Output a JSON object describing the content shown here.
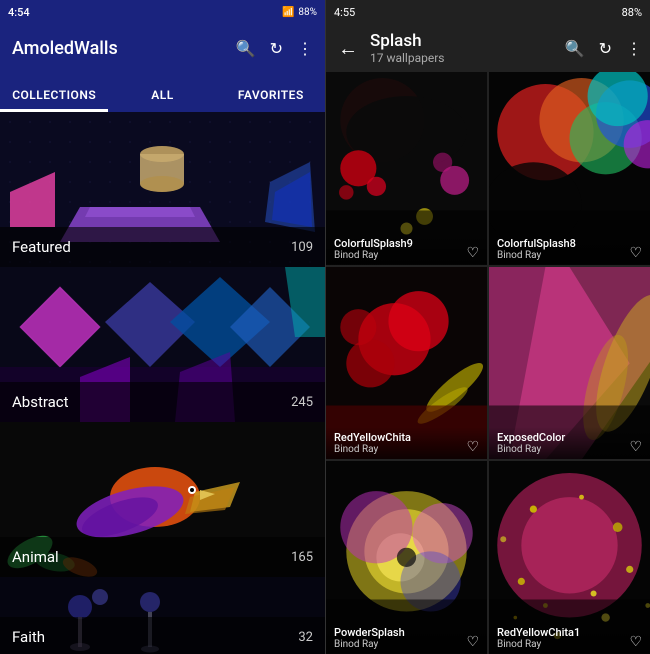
{
  "left": {
    "status": {
      "time": "4:54",
      "battery": "88%"
    },
    "appTitle": "AmoledWalls",
    "tabs": [
      {
        "label": "COLLECTIONS",
        "active": true
      },
      {
        "label": "ALL",
        "active": false
      },
      {
        "label": "FAVORITES",
        "active": false
      }
    ],
    "collections": [
      {
        "name": "Featured",
        "count": "109"
      },
      {
        "name": "Abstract",
        "count": "245"
      },
      {
        "name": "Animal",
        "count": "165"
      },
      {
        "name": "Faith",
        "count": "32"
      }
    ]
  },
  "right": {
    "status": {
      "time": "4:55",
      "battery": "88%"
    },
    "backLabel": "←",
    "title": "Splash",
    "subtitle": "17 wallpapers",
    "wallpapers": [
      {
        "name": "ColorfulSplash9",
        "author": "Binod Ray"
      },
      {
        "name": "ColorfulSplash8",
        "author": "Binod Ray"
      },
      {
        "name": "RedYellowChita",
        "author": "Binod Ray"
      },
      {
        "name": "ExposedColor",
        "author": "Binod Ray"
      },
      {
        "name": "PowderSplash",
        "author": "Binod Ray"
      },
      {
        "name": "RedYellowChita1",
        "author": "Binod Ray"
      }
    ]
  }
}
